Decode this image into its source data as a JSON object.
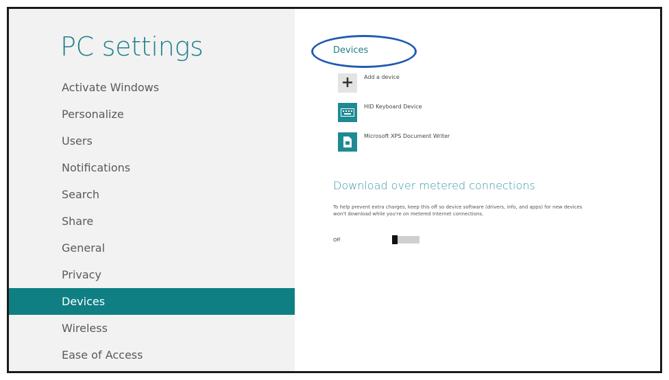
{
  "app": {
    "title": "PC settings"
  },
  "sidebar": {
    "items": [
      {
        "label": "Activate Windows"
      },
      {
        "label": "Personalize"
      },
      {
        "label": "Users"
      },
      {
        "label": "Notifications"
      },
      {
        "label": "Search"
      },
      {
        "label": "Share"
      },
      {
        "label": "General"
      },
      {
        "label": "Privacy"
      },
      {
        "label": "Devices",
        "selected": true
      },
      {
        "label": "Wireless"
      },
      {
        "label": "Ease of Access"
      }
    ]
  },
  "main": {
    "section_title": "Devices",
    "devices": [
      {
        "label": "Add a device",
        "icon": "plus-icon"
      },
      {
        "label": "HID Keyboard Device",
        "icon": "keyboard-icon"
      },
      {
        "label": "Microsoft XPS Document Writer",
        "icon": "printer-icon"
      }
    ],
    "metered": {
      "heading": "Download over metered connections",
      "description": "To help prevent extra charges, keep this off so device software (drivers, info, and apps) for new devices won't download while you're on metered Internet connections.",
      "state_label": "Off",
      "is_on": false
    }
  },
  "colors": {
    "accent": "#0f7f83",
    "title": "#1e7f8b",
    "annotation": "#1f5bb0"
  }
}
